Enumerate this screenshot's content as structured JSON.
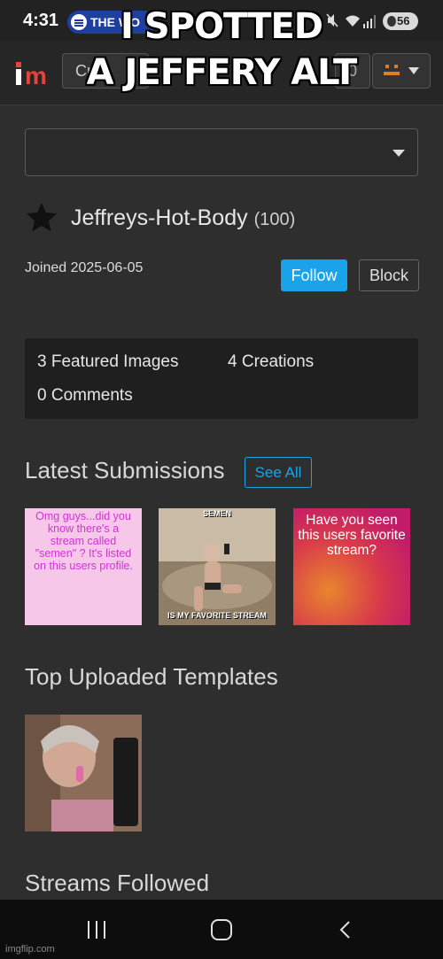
{
  "status_bar": {
    "time": "4:31",
    "media_app": "THE WO",
    "battery": "56"
  },
  "meme_caption": {
    "line1": "I SPOTTED",
    "line2": "A JEFFERY ALT"
  },
  "header": {
    "create_label": "Crea",
    "notification_count": "0",
    "brand_color": "#e8423a",
    "user_icon": "pixel-face-icon"
  },
  "profile": {
    "username": "Jeffreys-Hot-Body",
    "points": "(100)",
    "joined": "Joined 2025-06-05",
    "follow_label": "Follow",
    "block_label": "Block",
    "follow_color": "#1aa3e8"
  },
  "stats": {
    "featured": "3 Featured Images",
    "creations": "4 Creations",
    "comments": "0 Comments"
  },
  "latest": {
    "title": "Latest Submissions",
    "see_all": "See All",
    "items": [
      {
        "text": "Omg guys...did you know there's a stream called \"semen\" ? It's listed on this users profile."
      },
      {
        "top": "SEMEN",
        "bottom": "IS MY FAVORITE STREAM"
      },
      {
        "text": "Have you seen this users favorite stream?"
      }
    ]
  },
  "templates": {
    "title": "Top Uploaded Templates"
  },
  "streams": {
    "title": "Streams Followed"
  },
  "watermark": "imgflip.com"
}
